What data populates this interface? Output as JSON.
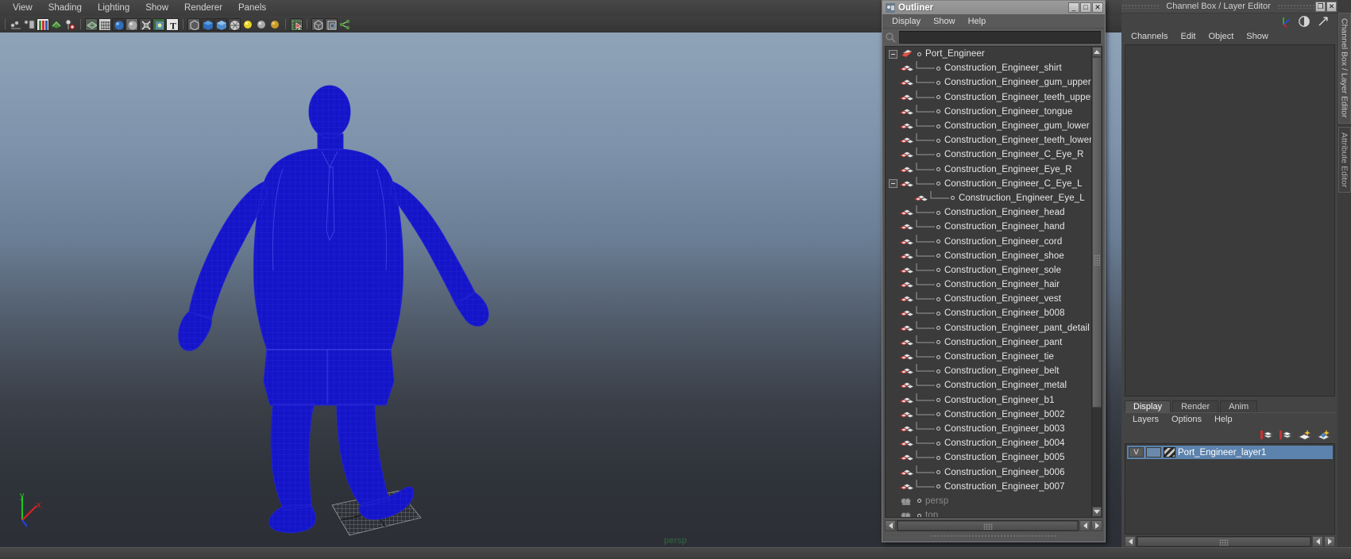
{
  "viewport": {
    "menus": [
      "View",
      "Shading",
      "Lighting",
      "Show",
      "Renderer",
      "Panels"
    ],
    "camera_label": "persp",
    "axis": {
      "x": "x",
      "y": "y",
      "z": "z"
    },
    "background_top": "#8fa3b8",
    "background_bottom": "#2c2f35",
    "wireframe_color": "#1414c8",
    "grid_color": "#b9b9b9",
    "toolbar_icons": [
      "snap-to-curve-icon",
      "snap-to-grid-icon",
      "snap-to-view-plane-icon",
      "render-current-frame-icon",
      "ipr-render-icon",
      "render-settings-icon",
      "display-smooth-shade-icon",
      "display-wireframe-icon",
      "display-shaded-icon",
      "display-textured-icon",
      "display-lights-icon",
      "display-xray-icon",
      "display-text-icon",
      "isolate-select-icon",
      "object-mode-icon",
      "component-mode-icon",
      "smooth-preview-icon",
      "light-bulb-icon",
      "grey-sphere-icon",
      "amber-sphere-icon",
      "select-tool-icon",
      "box-icon",
      "duplicate-icon",
      "share-icon"
    ]
  },
  "outliner": {
    "title": "Outliner",
    "title_icon": "outliner-window-icon",
    "window_buttons": {
      "minimize": "_",
      "maximize": "□",
      "close": "✕"
    },
    "menus": [
      "Display",
      "Show",
      "Help"
    ],
    "search_value": "",
    "search_placeholder": "",
    "tree": [
      {
        "label": "Port_Engineer",
        "level": 0,
        "icon": "transform-group-icon",
        "expander": "minus",
        "dim": false
      },
      {
        "label": "Construction_Engineer_shirt",
        "level": 1,
        "icon": "mesh-icon",
        "dim": false
      },
      {
        "label": "Construction_Engineer_gum_upper",
        "level": 1,
        "icon": "mesh-icon",
        "dim": false
      },
      {
        "label": "Construction_Engineer_teeth_upper",
        "level": 1,
        "icon": "mesh-icon",
        "dim": false
      },
      {
        "label": "Construction_Engineer_tongue",
        "level": 1,
        "icon": "mesh-icon",
        "dim": false
      },
      {
        "label": "Construction_Engineer_gum_lower",
        "level": 1,
        "icon": "mesh-icon",
        "dim": false
      },
      {
        "label": "Construction_Engineer_teeth_lower",
        "level": 1,
        "icon": "mesh-icon",
        "dim": false
      },
      {
        "label": "Construction_Engineer_C_Eye_R",
        "level": 1,
        "icon": "mesh-icon",
        "dim": false
      },
      {
        "label": "Construction_Engineer_Eye_R",
        "level": 1,
        "icon": "mesh-icon",
        "dim": false
      },
      {
        "label": "Construction_Engineer_C_Eye_L",
        "level": 1,
        "icon": "mesh-icon",
        "expander": "minus",
        "dim": false
      },
      {
        "label": "Construction_Engineer_Eye_L",
        "level": 2,
        "icon": "mesh-icon",
        "dim": false
      },
      {
        "label": "Construction_Engineer_head",
        "level": 1,
        "icon": "mesh-icon",
        "dim": false
      },
      {
        "label": "Construction_Engineer_hand",
        "level": 1,
        "icon": "mesh-icon",
        "dim": false
      },
      {
        "label": "Construction_Engineer_cord",
        "level": 1,
        "icon": "mesh-icon",
        "dim": false
      },
      {
        "label": "Construction_Engineer_shoe",
        "level": 1,
        "icon": "mesh-icon",
        "dim": false
      },
      {
        "label": "Construction_Engineer_sole",
        "level": 1,
        "icon": "mesh-icon",
        "dim": false
      },
      {
        "label": "Construction_Engineer_hair",
        "level": 1,
        "icon": "mesh-icon",
        "dim": false
      },
      {
        "label": "Construction_Engineer_vest",
        "level": 1,
        "icon": "mesh-icon",
        "dim": false
      },
      {
        "label": "Construction_Engineer_b008",
        "level": 1,
        "icon": "mesh-icon",
        "dim": false
      },
      {
        "label": "Construction_Engineer_pant_detail",
        "level": 1,
        "icon": "mesh-icon",
        "dim": false
      },
      {
        "label": "Construction_Engineer_pant",
        "level": 1,
        "icon": "mesh-icon",
        "dim": false
      },
      {
        "label": "Construction_Engineer_tie",
        "level": 1,
        "icon": "mesh-icon",
        "dim": false
      },
      {
        "label": "Construction_Engineer_belt",
        "level": 1,
        "icon": "mesh-icon",
        "dim": false
      },
      {
        "label": "Construction_Engineer_metal",
        "level": 1,
        "icon": "mesh-icon",
        "dim": false
      },
      {
        "label": "Construction_Engineer_b1",
        "level": 1,
        "icon": "mesh-icon",
        "dim": false
      },
      {
        "label": "Construction_Engineer_b002",
        "level": 1,
        "icon": "mesh-icon",
        "dim": false
      },
      {
        "label": "Construction_Engineer_b003",
        "level": 1,
        "icon": "mesh-icon",
        "dim": false
      },
      {
        "label": "Construction_Engineer_b004",
        "level": 1,
        "icon": "mesh-icon",
        "dim": false
      },
      {
        "label": "Construction_Engineer_b005",
        "level": 1,
        "icon": "mesh-icon",
        "dim": false
      },
      {
        "label": "Construction_Engineer_b006",
        "level": 1,
        "icon": "mesh-icon",
        "dim": false
      },
      {
        "label": "Construction_Engineer_b007",
        "level": 1,
        "icon": "mesh-icon",
        "dim": false
      },
      {
        "label": "persp",
        "level": 0,
        "icon": "camera-icon",
        "dim": true
      },
      {
        "label": "top",
        "level": 0,
        "icon": "camera-icon",
        "dim": true
      }
    ]
  },
  "right_panel": {
    "title": "Channel Box / Layer Editor",
    "window_buttons": {
      "restore": "❐",
      "close": "✕"
    },
    "header_icons": [
      "axis-orientation-icon",
      "contrast-toggle-icon",
      "expand-arrow-icon"
    ],
    "menus": [
      "Channels",
      "Edit",
      "Object",
      "Show"
    ],
    "channel_values": []
  },
  "layer_editor": {
    "tabs": [
      {
        "label": "Display",
        "active": true
      },
      {
        "label": "Render",
        "active": false
      },
      {
        "label": "Anim",
        "active": false
      }
    ],
    "menus": [
      "Layers",
      "Options",
      "Help"
    ],
    "tool_icons": [
      "new-layer-icon",
      "new-layer-from-selected-icon",
      "layer-highlight-icon",
      "layer-membership-icon"
    ],
    "layers": [
      {
        "visibility": "V",
        "playback": "",
        "name": "Port_Engineer_layer1",
        "selected": true,
        "color": "#5c83ad"
      }
    ]
  },
  "edge_tabs": [
    {
      "label": "Channel Box / Layer Editor",
      "active": true
    },
    {
      "label": "Attribute Editor",
      "active": false
    }
  ]
}
